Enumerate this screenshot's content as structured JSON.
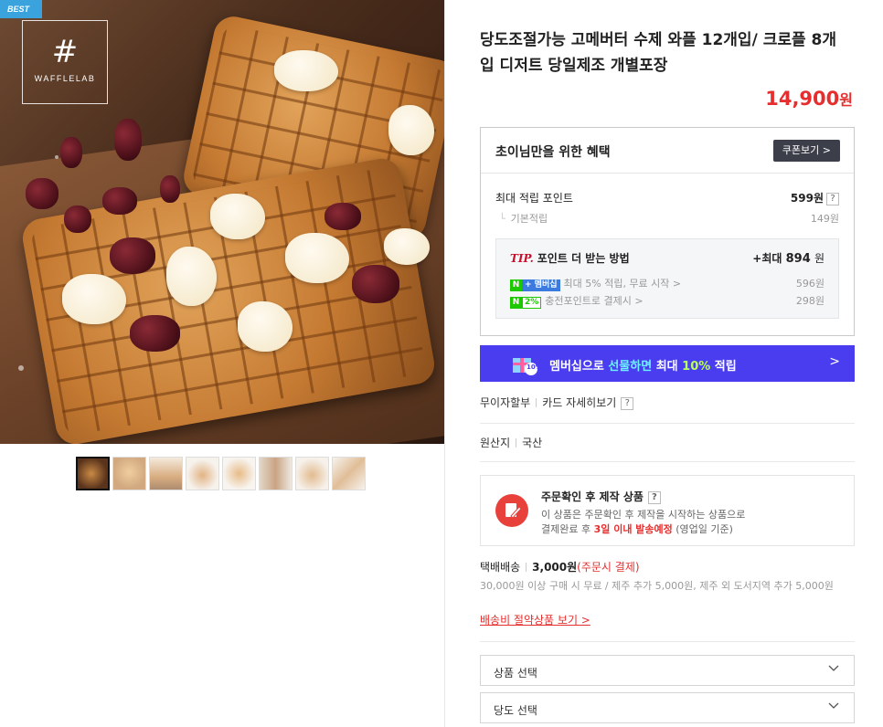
{
  "gallery": {
    "badge": "BEST",
    "logo_text": "WAFFLELAB",
    "thumbnails": [
      "thumb-1",
      "thumb-2",
      "thumb-3",
      "thumb-4",
      "thumb-5",
      "thumb-6",
      "thumb-7",
      "thumb-8"
    ]
  },
  "product": {
    "title": "당도조절가능 고메버터 수제 와플 12개입/ 크로플 8개입 디저트 당일제조 개별포장",
    "price": "14,900",
    "price_unit": "원"
  },
  "benefit": {
    "title": "초이님만을 위한 혜택",
    "coupon_button": "쿠폰보기 >",
    "max_points_label": "최대 적립 포인트",
    "max_points_value": "599원",
    "help": "?",
    "base_label": "기본적립",
    "base_value": "149원",
    "tip_prefix": "TIP.",
    "tip_title": "포인트 더 받는 방법",
    "tip_max_prefix": "+최대",
    "tip_max_value": "894",
    "tip_max_unit": "원",
    "tip_rows": [
      {
        "badge_n": "N",
        "badge_extra": "+ 멤버십",
        "label": "최대 5% 적립, 무료 시작 >",
        "value": "596원"
      },
      {
        "badge_n": "N",
        "badge_extra": "2%",
        "label": "충전포인트로 결제시 >",
        "value": "298원"
      }
    ]
  },
  "membership_banner": {
    "icon_badge": "10%",
    "text_a": "멤버십으로 ",
    "text_b": "선물하면",
    "text_c": " 최대 ",
    "text_d": "10%",
    "text_e": " 적립",
    "arrow": ">"
  },
  "installment": {
    "label": "무이자할부",
    "link": "카드 자세히보기",
    "help": "?"
  },
  "origin": {
    "label": "원산지",
    "value": "국산"
  },
  "notice": {
    "title": "주문확인 후 제작 상품",
    "help": "?",
    "line1": "이 상품은 주문확인 후 제작을 시작하는 상품으로",
    "line2_a": "결제완료 후 ",
    "line2_b": "3일 이내 발송예정",
    "line2_c": " (영업일 기준)"
  },
  "shipping": {
    "label": "택배배송",
    "amount": "3,000원",
    "note": "(주문시 결제)",
    "desc": "30,000원 이상 구매 시 무료 / 제주 추가 5,000원, 제주 외 도서지역 추가 5,000원",
    "link": "배송비 절약상품 보기 >"
  },
  "options": {
    "product_select": "상품 선택",
    "sweetness_select": "당도 선택"
  },
  "colors": {
    "price_red": "#e62e2e",
    "banner_purple": "#4a3df0",
    "naver_green": "#1ec800",
    "best_blue": "#3aa3dd"
  }
}
